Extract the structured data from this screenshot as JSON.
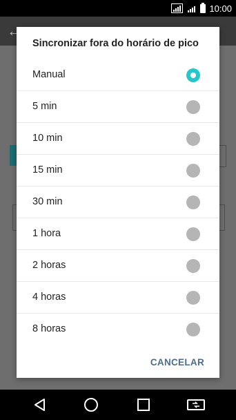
{
  "status_bar": {
    "time": "10:00",
    "signal1_label": "3G",
    "signal2_label": "3G"
  },
  "dialog": {
    "title": "Sincronizar fora do horário de pico",
    "options": [
      {
        "label": "Manual",
        "selected": true
      },
      {
        "label": "5 min",
        "selected": false
      },
      {
        "label": "10 min",
        "selected": false
      },
      {
        "label": "15 min",
        "selected": false
      },
      {
        "label": "30 min",
        "selected": false
      },
      {
        "label": "1 hora",
        "selected": false
      },
      {
        "label": "2 horas",
        "selected": false
      },
      {
        "label": "4 horas",
        "selected": false
      },
      {
        "label": "8 horas",
        "selected": false
      }
    ],
    "cancel_label": "CANCELAR"
  },
  "colors": {
    "accent": "#27c6ca",
    "unselected": "#b5b5b5",
    "button_text": "#4d6b8a"
  },
  "nav_bar": {
    "icons": [
      "back-icon",
      "home-icon",
      "recents-icon",
      "dual-window-icon"
    ]
  }
}
